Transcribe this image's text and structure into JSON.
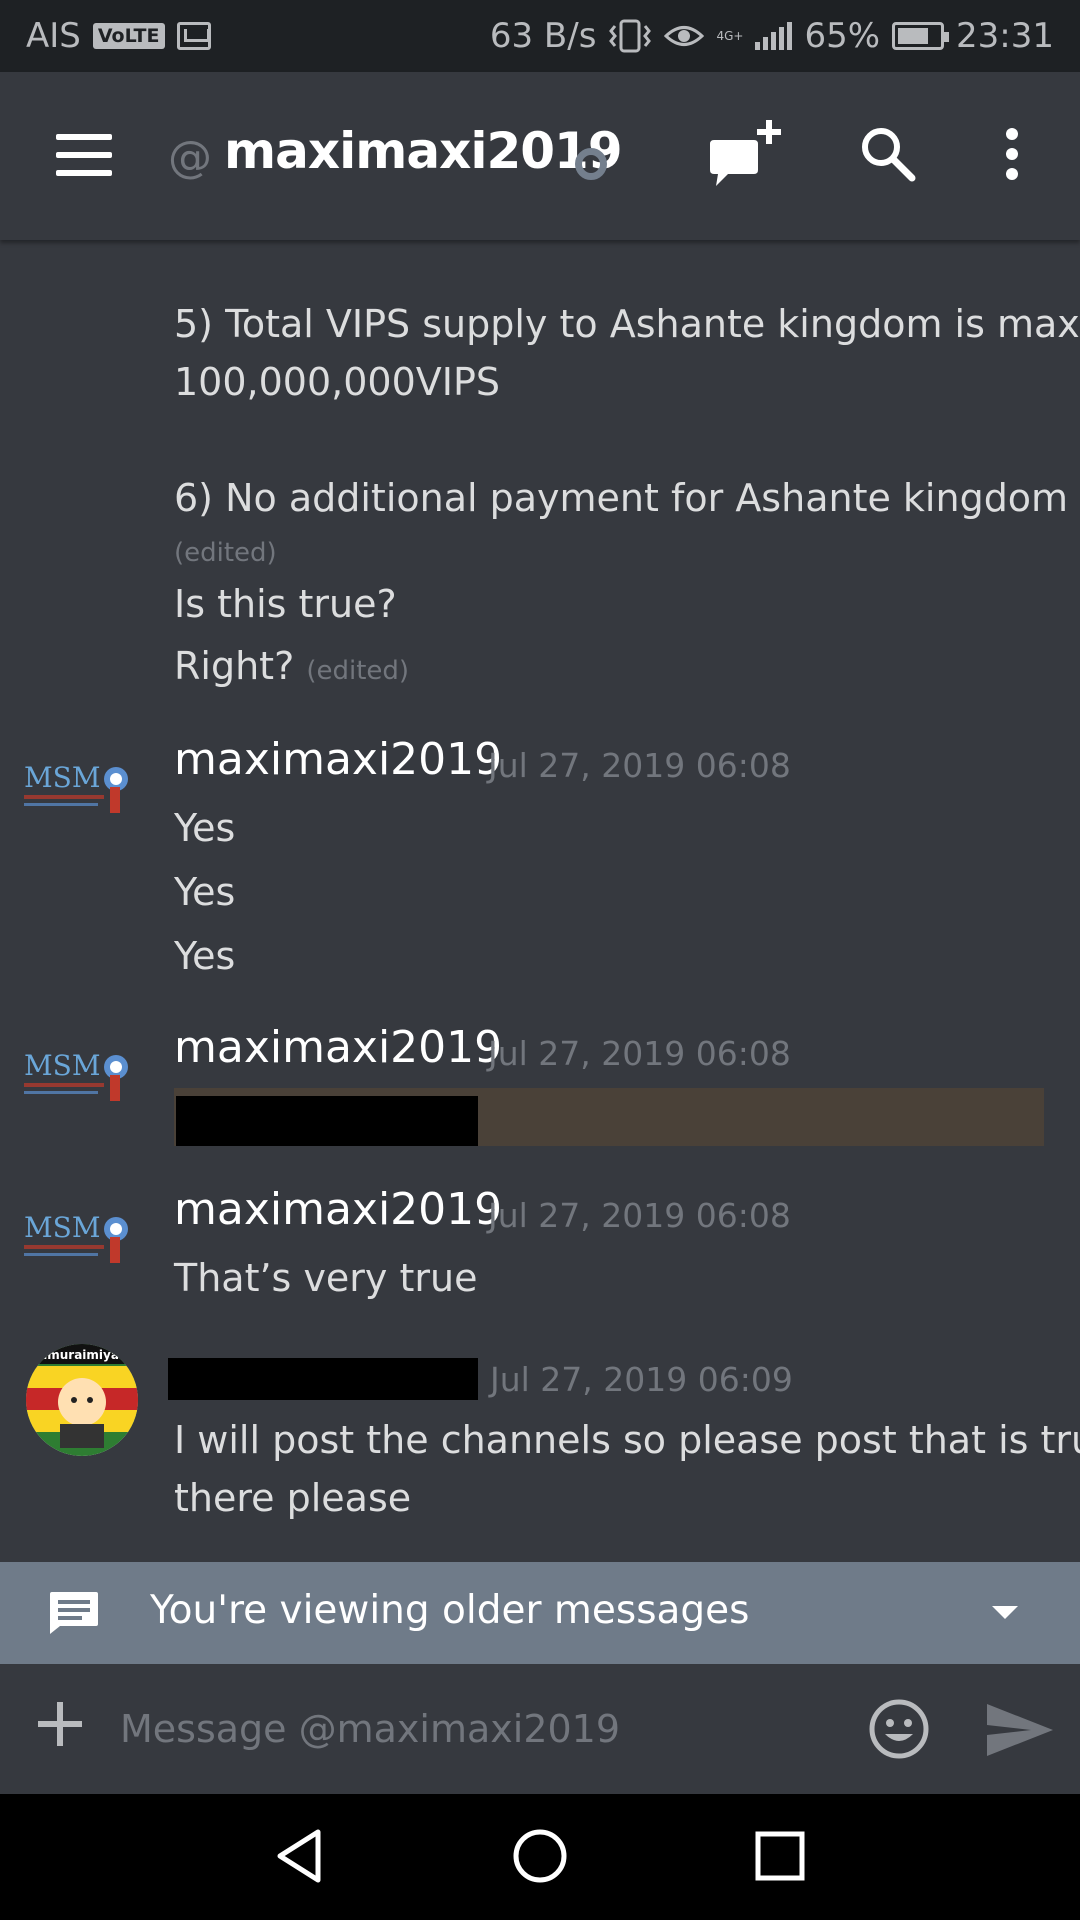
{
  "status_bar": {
    "carrier": "AIS",
    "volte": "VoLTE",
    "net_speed": "63 B/s",
    "network_type": "4G+",
    "battery_percent": "65%",
    "battery_level": 0.65,
    "time": "23:31"
  },
  "header": {
    "at_symbol": "@",
    "title": "maximaxi2019",
    "icons": [
      "menu-icon",
      "new-dm-icon",
      "search-icon",
      "more-icon"
    ]
  },
  "messages": {
    "continuation_lines": [
      "5) Total VIPS supply to Ashante kingdom is max",
      "100,000,000VIPS",
      "6) No additional payment for Ashante kingdom",
      "Is this true?",
      "Right?"
    ],
    "edited_label": "(edited)",
    "groups": [
      {
        "author": "maximaxi2019",
        "timestamp": "Jul 27, 2019 06:08",
        "lines": [
          "Yes",
          "Yes",
          "Yes"
        ]
      },
      {
        "author": "maximaxi2019",
        "timestamp": "Jul 27, 2019 06:08",
        "lines": []
      },
      {
        "author": "maximaxi2019",
        "timestamp": "Jul 27, 2019 06:08",
        "lines": [
          "That’s very true"
        ]
      },
      {
        "author": "",
        "timestamp": "Jul 27, 2019 06:09",
        "lines": [
          "I will post the channels so please post that is true",
          "there please"
        ]
      }
    ],
    "avatar_text": "MSM",
    "avatar2_text": "samuraimiyab"
  },
  "older_bar": {
    "text": "You're viewing older messages"
  },
  "input": {
    "placeholder": "Message @maximaxi2019"
  },
  "colors": {
    "background": "#36393f",
    "older_bar": "#6f7b89",
    "text": "#dcddde",
    "muted": "#72767d"
  }
}
